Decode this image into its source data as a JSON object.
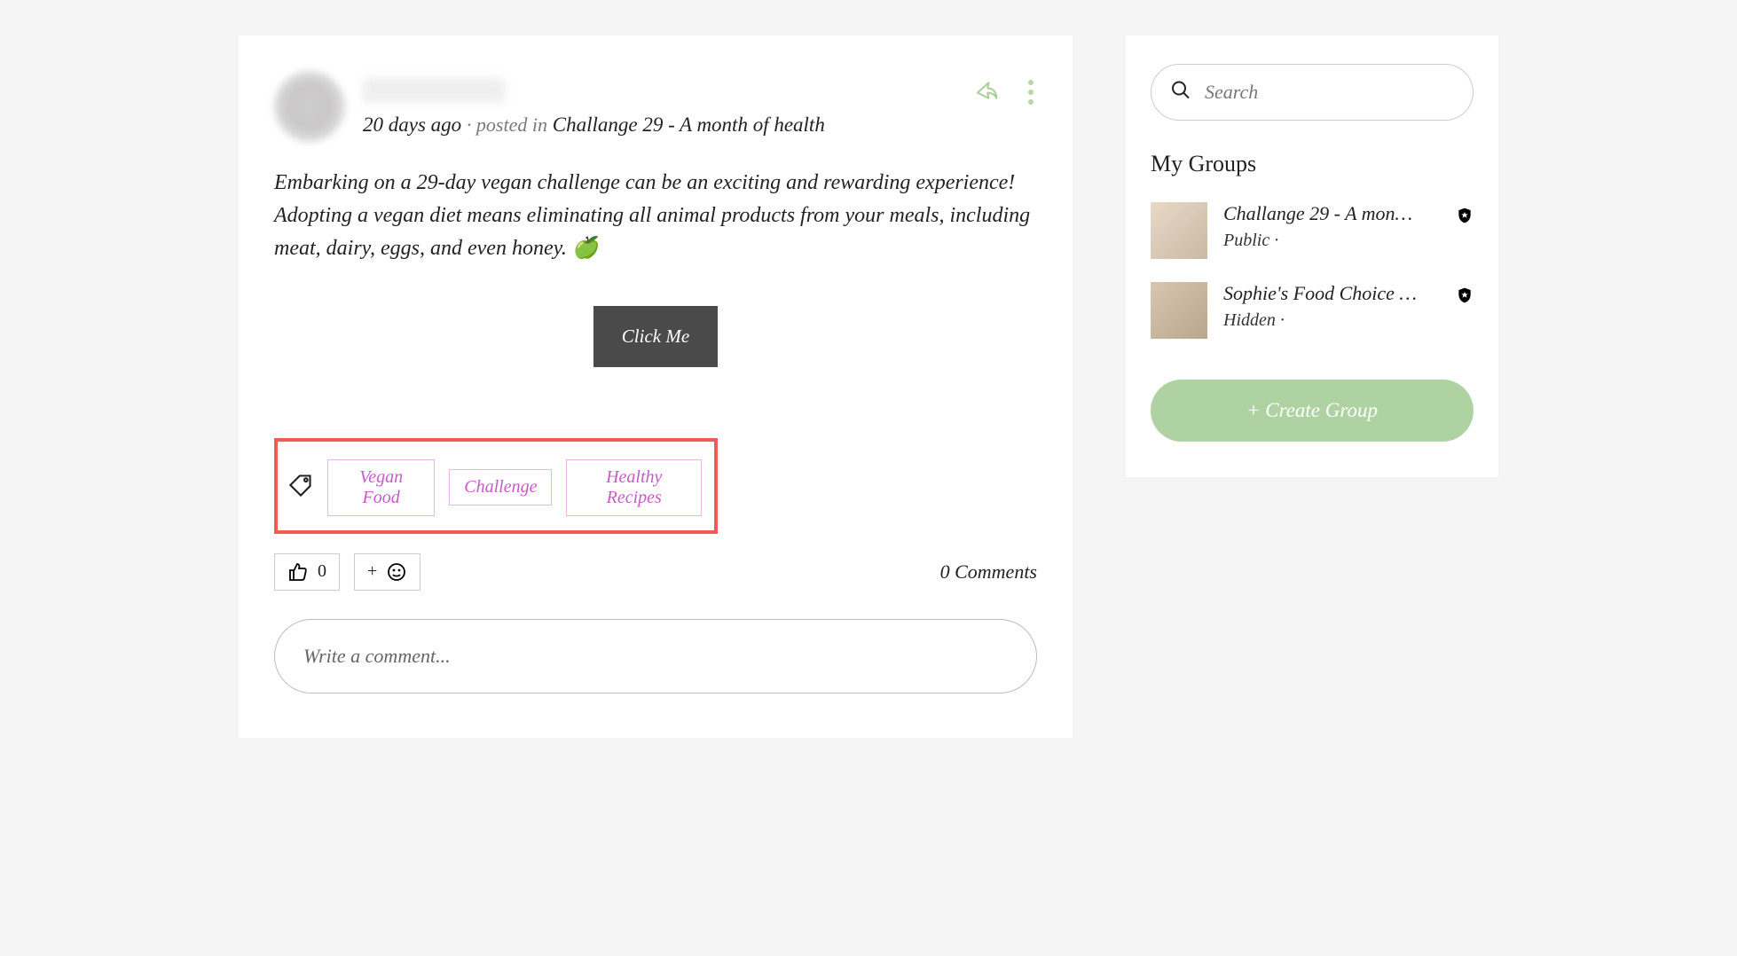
{
  "post": {
    "time_ago": "20 days ago",
    "posted_in_label": "posted in",
    "group_name": "Challange 29 - A month of health",
    "body": "Embarking on a 29-day vegan challenge can be an exciting and rewarding experience! Adopting a vegan diet means eliminating all animal products from your meals, including meat, dairy, eggs, and even honey. 🍏",
    "cta_label": "Click Me",
    "tags": [
      "Vegan Food",
      "Challenge",
      "Healthy Recipes"
    ],
    "like_count": "0",
    "comments_count_label": "0 Comments",
    "comment_placeholder": "Write a comment..."
  },
  "sidebar": {
    "search_placeholder": "Search",
    "my_groups_title": "My Groups",
    "groups": [
      {
        "name": "Challange 29 - A mon…",
        "privacy": "Public ·"
      },
      {
        "name": "Sophie's Food Choice …",
        "privacy": "Hidden ·"
      }
    ],
    "create_group_label": "+ Create Group"
  }
}
